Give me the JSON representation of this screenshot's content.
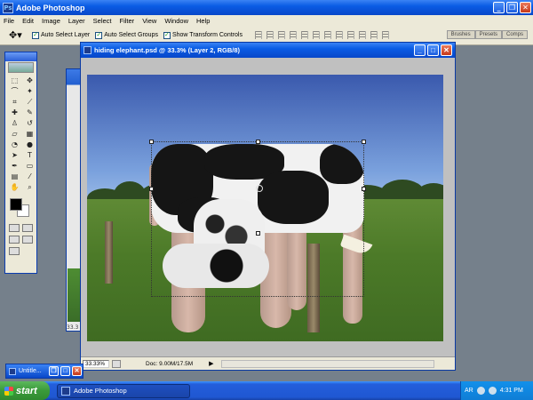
{
  "app": {
    "title": "Adobe Photoshop"
  },
  "menu": [
    "File",
    "Edit",
    "Image",
    "Layer",
    "Select",
    "Filter",
    "View",
    "Window",
    "Help"
  ],
  "options": {
    "auto_select_layer": "Auto Select Layer",
    "auto_select_groups": "Auto Select Groups",
    "show_transform_controls": "Show Transform Controls"
  },
  "palettes": [
    "Brushes",
    "Presets",
    "Comps"
  ],
  "document": {
    "title": "hiding elephant.psd @ 33.3% (Layer 2, RGB/8)",
    "zoom": "33.33%",
    "doc_info": "Doc: 9.00M/17.5M"
  },
  "background_doc": {
    "zoom": "33.3"
  },
  "minimized_doc": {
    "title": "Untitle..."
  },
  "taskbar": {
    "start": "start",
    "task": "Adobe Photoshop",
    "lang": "AR",
    "time": "4:31 PM"
  }
}
